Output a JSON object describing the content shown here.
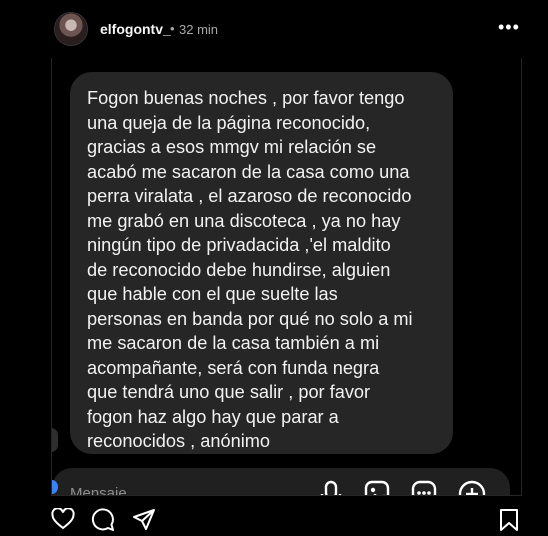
{
  "header": {
    "username": "elfogontv_",
    "separator": "•",
    "time": "32 min",
    "more_label": "•••"
  },
  "message": {
    "text": "Fogon buenas noches , por favor tengo\nuna queja de la página reconocido,\ngracias a esos mmgv mi relación se\nacabó me sacaron de la casa como una\nperra viralata , el azaroso de reconocido\nme grabó en una discoteca , ya no hay\nningún tipo de privadacida ,'el maldito\nde reconocido debe hundirse, alguien\nque hable con el que suelte las\npersonas en banda por qué no solo a mi\nme sacaron de la casa también a mi\nacompañante, será con funda negra\nque tendrá uno que salir , por favor\nfogon haz algo hay que parar a\nreconocidos , anónimo"
  },
  "composer": {
    "placeholder": "Mensaje...",
    "icons": [
      "microphone-icon",
      "image-icon",
      "sticker-icon",
      "add-icon"
    ]
  },
  "bottom_bar": {
    "icons": [
      "heart-icon",
      "comment-icon",
      "share-icon",
      "bookmark-icon"
    ]
  }
}
